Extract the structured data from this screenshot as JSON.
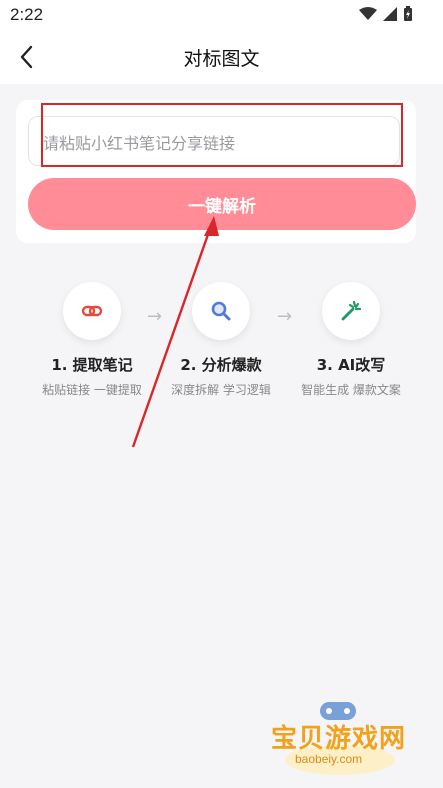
{
  "status_bar": {
    "time": "2:22"
  },
  "header": {
    "title": "对标图文"
  },
  "input": {
    "placeholder": "请粘贴小红书笔记分享链接"
  },
  "parse_button": {
    "label": "一键解析"
  },
  "steps": [
    {
      "title": "1. 提取笔记",
      "desc": "粘贴链接 一键提取",
      "icon": "link-icon"
    },
    {
      "title": "2. 分析爆款",
      "desc": "深度拆解 学习逻辑",
      "icon": "search-icon"
    },
    {
      "title": "3. AI改写",
      "desc": "智能生成 爆款文案",
      "icon": "magic-wand-icon"
    }
  ],
  "watermark": {
    "text": "宝贝游戏网",
    "url": "baobeiy.com"
  },
  "colors": {
    "accent": "#ff8c97",
    "annotation": "#d9262b",
    "background": "#f5f5f7"
  }
}
